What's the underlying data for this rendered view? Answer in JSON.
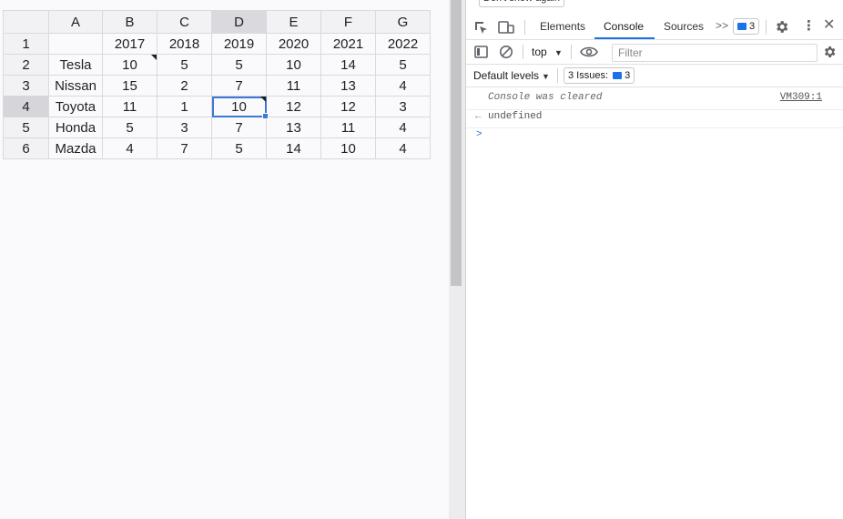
{
  "sheet": {
    "columns": [
      "A",
      "B",
      "C",
      "D",
      "E",
      "F",
      "G"
    ],
    "active_column": "D",
    "active_row": "4",
    "rows": [
      {
        "num": "1",
        "cells": [
          "",
          "2017",
          "2018",
          "2019",
          "2020",
          "2021",
          "2022"
        ]
      },
      {
        "num": "2",
        "cells": [
          "Tesla",
          "10",
          "5",
          "5",
          "10",
          "14",
          "5"
        ]
      },
      {
        "num": "3",
        "cells": [
          "Nissan",
          "15",
          "2",
          "7",
          "11",
          "13",
          "4"
        ]
      },
      {
        "num": "4",
        "cells": [
          "Toyota",
          "11",
          "1",
          "10",
          "12",
          "12",
          "3"
        ]
      },
      {
        "num": "5",
        "cells": [
          "Honda",
          "5",
          "3",
          "7",
          "13",
          "11",
          "4"
        ]
      },
      {
        "num": "6",
        "cells": [
          "Mazda",
          "4",
          "7",
          "5",
          "14",
          "10",
          "4"
        ]
      }
    ]
  },
  "devtools": {
    "dont_show_label": "Don't show again",
    "tabs": [
      "Elements",
      "Console",
      "Sources"
    ],
    "active_tab": "Console",
    "more_tabs_icon": ">>",
    "issues_badge_count": "3",
    "context_selector": "top",
    "filter_placeholder": "Filter",
    "levels_label": "Default levels",
    "issues_label": "3 Issues:",
    "issues_count": "3",
    "console": {
      "cleared_message": "Console was cleared",
      "cleared_source": "VM309:1",
      "result_arrow": "←",
      "result_value": "undefined",
      "prompt": ">"
    }
  },
  "colors": {
    "selection_accent": "#3c79d4",
    "devtools_accent": "#1a73e8"
  }
}
